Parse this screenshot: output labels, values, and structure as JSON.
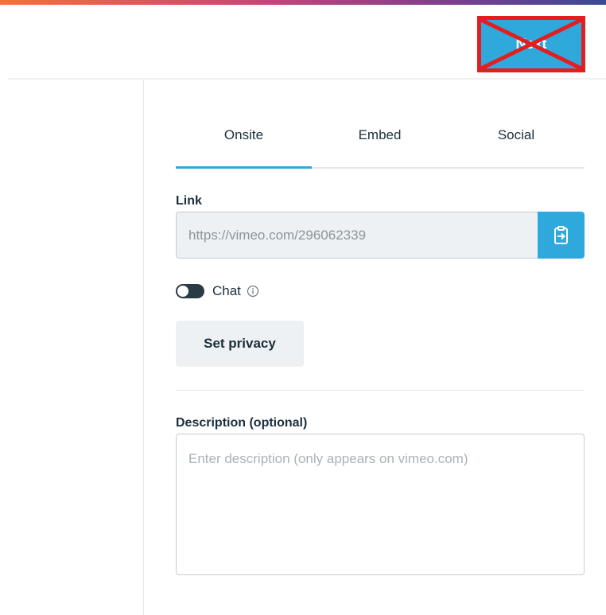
{
  "header": {
    "next_label": "Next"
  },
  "tabs": [
    {
      "label": "Onsite",
      "active": true
    },
    {
      "label": "Embed",
      "active": false
    },
    {
      "label": "Social",
      "active": false
    }
  ],
  "link": {
    "label": "Link",
    "value": "https://vimeo.com/296062339",
    "copy_icon": "copy-link-icon"
  },
  "chat": {
    "label": "Chat",
    "enabled": false,
    "info_icon": "info-icon"
  },
  "privacy": {
    "button_label": "Set privacy"
  },
  "description": {
    "label": "Description (optional)",
    "placeholder": "Enter description (only appears on vimeo.com)",
    "value": ""
  },
  "colors": {
    "accent": "#2fa8dc",
    "text": "#1a2e3b",
    "annotation_red": "#e31e1e"
  }
}
